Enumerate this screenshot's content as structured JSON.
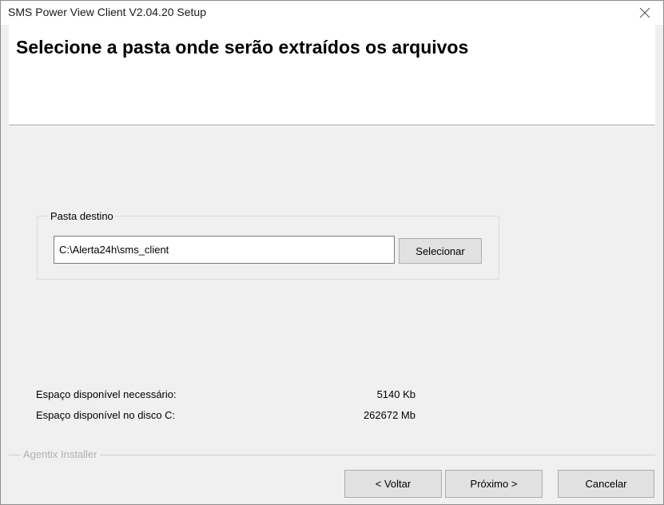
{
  "window": {
    "title": "SMS Power View Client V2.04.20 Setup"
  },
  "header": {
    "title": "Selecione a pasta onde serão extraídos os arquivos"
  },
  "destination": {
    "group_label": "Pasta destino",
    "path_value": "C:\\Alerta24h\\sms_client",
    "select_label": "Selecionar"
  },
  "space": {
    "required_label": "Espaço disponível necessário:",
    "required_value": "5140 Kb",
    "available_label": "Espaço disponível no disco C:",
    "available_value": "262672 Mb"
  },
  "footer": {
    "brand": "Agentix Installer",
    "back_label": "< Voltar",
    "next_label": "Próximo >",
    "cancel_label": "Cancelar"
  },
  "icons": {
    "close": "close-icon"
  }
}
